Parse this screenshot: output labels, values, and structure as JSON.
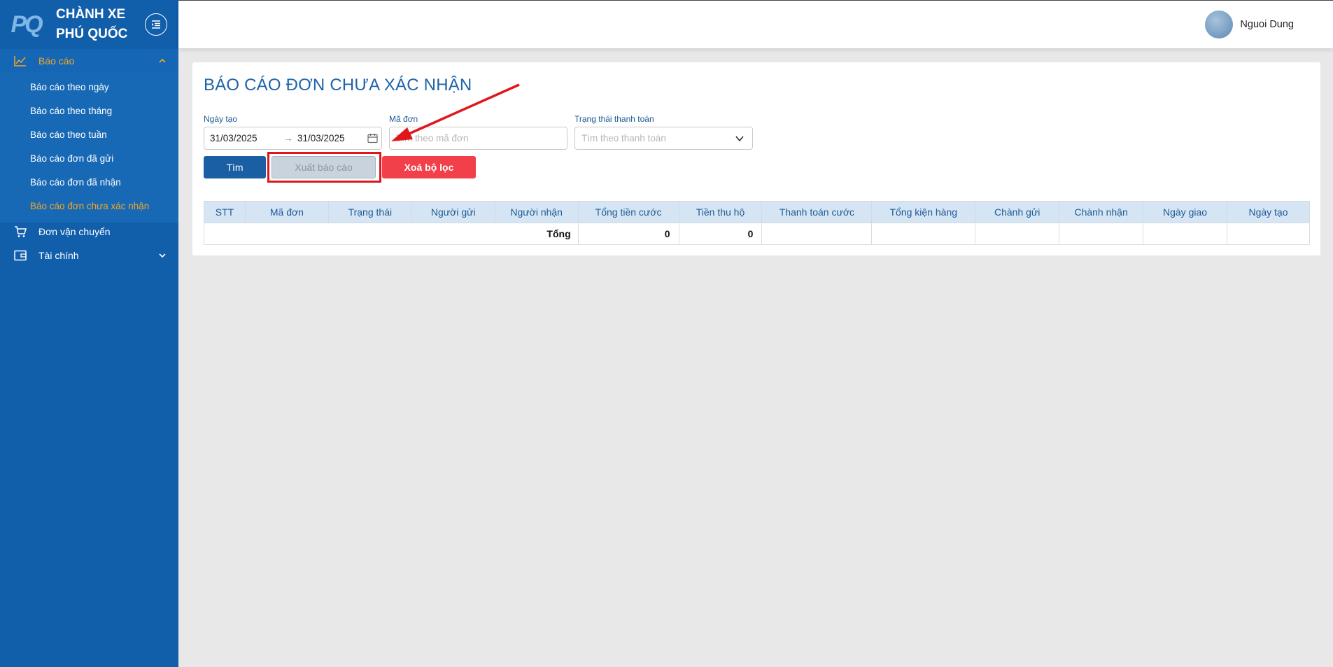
{
  "brand": {
    "logo_text": "PQ",
    "line1": "CHÀNH XE",
    "line2": "PHÚ QUỐC"
  },
  "sidebar": {
    "groups": [
      {
        "label": "Báo cáo",
        "icon": "line-chart-icon",
        "expanded": true
      },
      {
        "label": "Đơn vận chuyển",
        "icon": "cart-icon"
      },
      {
        "label": "Tài chính",
        "icon": "wallet-icon",
        "expanded": false
      }
    ],
    "report_items": [
      "Báo cáo theo ngày",
      "Báo cáo theo tháng",
      "Báo cáo theo tuần",
      "Báo cáo đơn đã gửi",
      "Báo cáo đơn đã nhận",
      "Báo cáo đơn chưa xác nhận"
    ],
    "active_color": "#f5a623",
    "background": "#115eab"
  },
  "header": {
    "user_name": "Nguoi Dung"
  },
  "page": {
    "title": "BÁO CÁO ĐƠN CHƯA XÁC NHẬN",
    "filters": {
      "date_label": "Ngày tạo",
      "date_from": "31/03/2025",
      "date_sep": "→",
      "date_to": "31/03/2025",
      "code_label": "Mã đơn",
      "code_placeholder": "Tìm theo mã đơn",
      "payment_label": "Trạng thái thanh toán",
      "payment_placeholder": "Tìm theo thanh toán"
    },
    "buttons": {
      "search": "Tìm",
      "export": "Xuất báo cáo",
      "clear": "Xoá bộ lọc"
    },
    "table": {
      "headers": [
        "STT",
        "Mã đơn",
        "Trạng thái",
        "Người gửi",
        "Người nhận",
        "Tổng tiền cước",
        "Tiền thu hộ",
        "Thanh toán cước",
        "Tổng kiện hàng",
        "Chành gửi",
        "Chành nhận",
        "Ngày giao",
        "Ngày tạo"
      ],
      "total_label": "Tổng",
      "total_freight": "0",
      "total_cod": "0"
    }
  },
  "annotation": {
    "highlight_color": "#e0161c"
  }
}
